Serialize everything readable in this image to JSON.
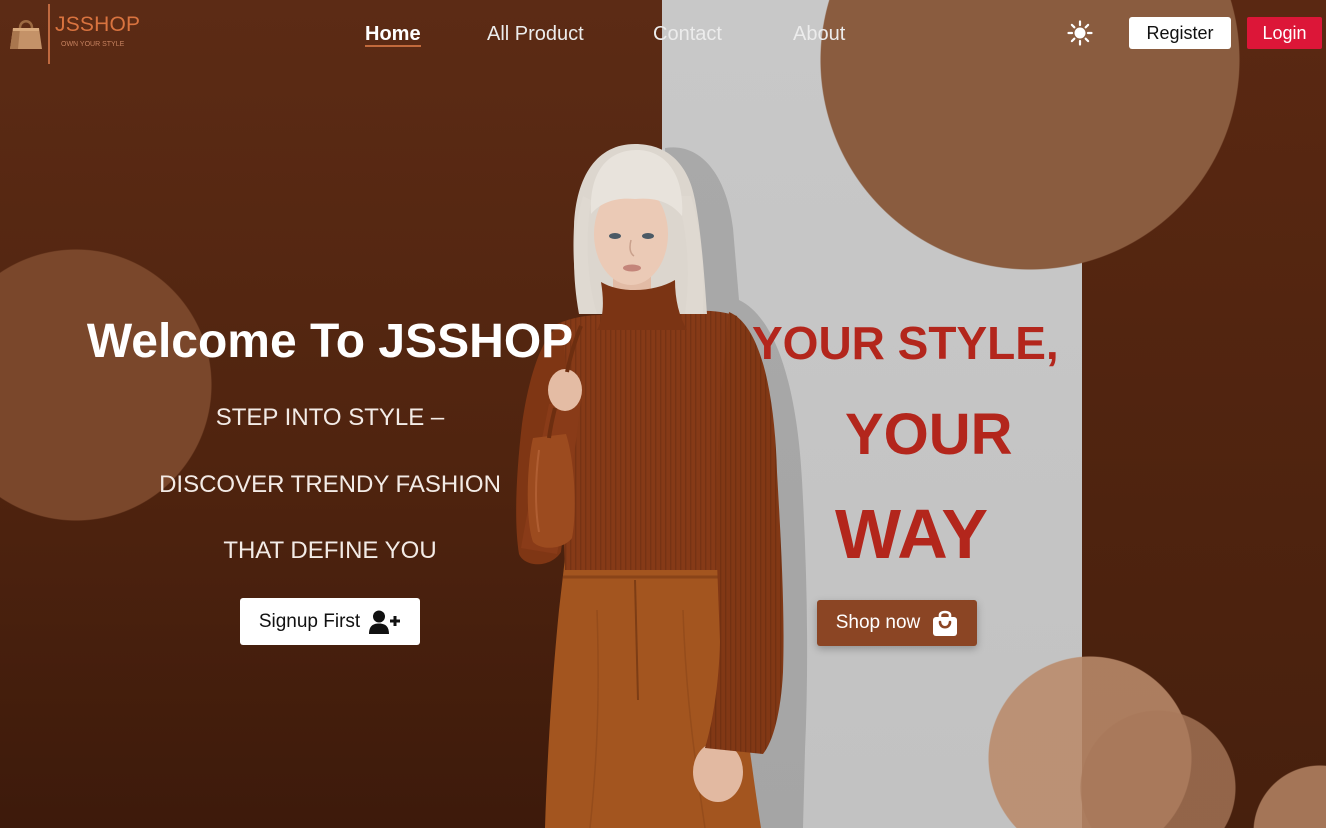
{
  "brand": {
    "name": "JSSHOP",
    "tagline": "OWN YOUR STYLE",
    "logo_icon": "shopping-bag-logo-icon"
  },
  "nav": {
    "links": [
      {
        "label": "Home",
        "active": true
      },
      {
        "label": "All Product",
        "active": false
      },
      {
        "label": "Contact",
        "active": false
      },
      {
        "label": "About",
        "active": false
      }
    ]
  },
  "actions": {
    "theme_toggle_icon": "sun-icon",
    "register_label": "Register",
    "login_label": "Login"
  },
  "hero": {
    "title": "Welcome To JSSHOP",
    "tagline_lines": [
      "STEP INTO STYLE –",
      "DISCOVER TRENDY FASHION",
      "THAT DEFINE YOU"
    ],
    "signup_button": {
      "label": "Signup First",
      "icon": "user-plus-icon"
    },
    "slogan_lines": [
      "YOUR STYLE,",
      "YOUR",
      "WAY"
    ],
    "shop_button": {
      "label": "Shop now",
      "icon": "shopping-bag-icon"
    }
  },
  "colors": {
    "background_brown": "#5a2812",
    "panel_grey": "#c8c8c8",
    "circle_tan": "#8a5c3f",
    "brand_orange": "#d9733f",
    "slogan_red": "#b3261c",
    "login_red": "#dc1638",
    "shop_button_brown": "#8b4524",
    "text_light": "#f3ebe6"
  }
}
